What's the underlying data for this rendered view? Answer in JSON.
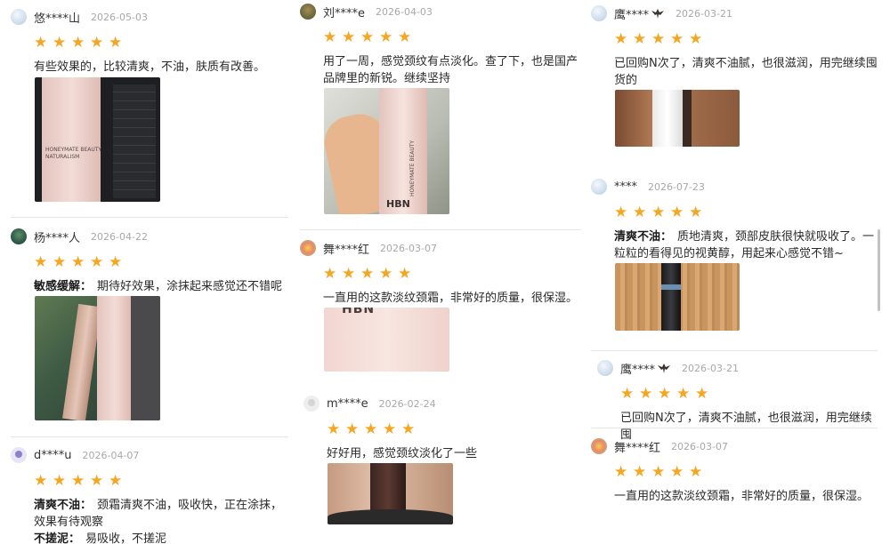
{
  "rating_stars": 5,
  "colors": {
    "star": "#f5a623",
    "date": "#a8a8a8",
    "divider": "#e6e6e6"
  },
  "reviews": [
    {
      "user": "悠****山",
      "date": "2026-05-03",
      "text": "有些效果的，比较清爽，不油，肤质有改善。"
    },
    {
      "user": "杨****人",
      "date": "2026-04-22",
      "tag": "敏感缓解：",
      "text": "期待好效果，涂抹起来感觉还不错呢"
    },
    {
      "user": "d****u",
      "date": "2026-04-07",
      "tag": "清爽不油：",
      "text": "颈霜清爽不油，吸收快，正在涂抹，效果有待观察",
      "tag2": "不搓泥：",
      "text2": "易吸收，不搓泥"
    },
    {
      "user": "刘****e",
      "date": "2026-04-03",
      "text": "用了一周，感觉颈纹有点淡化。查了下，也是国产品牌里的新锐。继续坚持"
    },
    {
      "user": "舞****红",
      "date": "2026-03-07",
      "text": "一直用的这款淡纹颈霜，非常好的质量，很保湿。"
    },
    {
      "user": "m****e",
      "date": "2026-02-24",
      "text": "好好用，感觉颈纹淡化了一些"
    },
    {
      "user": "鹰****",
      "date": "2026-03-21",
      "text": "已回购N次了，清爽不油腻，也很滋润，用完继续囤货的"
    },
    {
      "user": "****",
      "date": "2026-07-23",
      "tag": "清爽不油：",
      "text": "质地清爽，颈部皮肤很快就吸收了。一粒粒的看得见的视黄醇，用起来心感觉不错~"
    },
    {
      "user": "鹰****",
      "date": "2026-03-21",
      "text": "已回购N次了，清爽不油腻，也很滋润，用完继续囤"
    },
    {
      "user": "舞****红",
      "date": "2026-03-07",
      "text": "一直用的这款淡纹颈霜，非常好的质量，很保湿。"
    }
  ],
  "product": {
    "brand_line1": "HONEYMATE BEAUTY",
    "brand_line2": "NATURALISM",
    "logo": "HBN",
    "logo_partial": "HBN"
  },
  "icons": [
    "avatar-icon",
    "star-icon",
    "eagle-icon"
  ]
}
